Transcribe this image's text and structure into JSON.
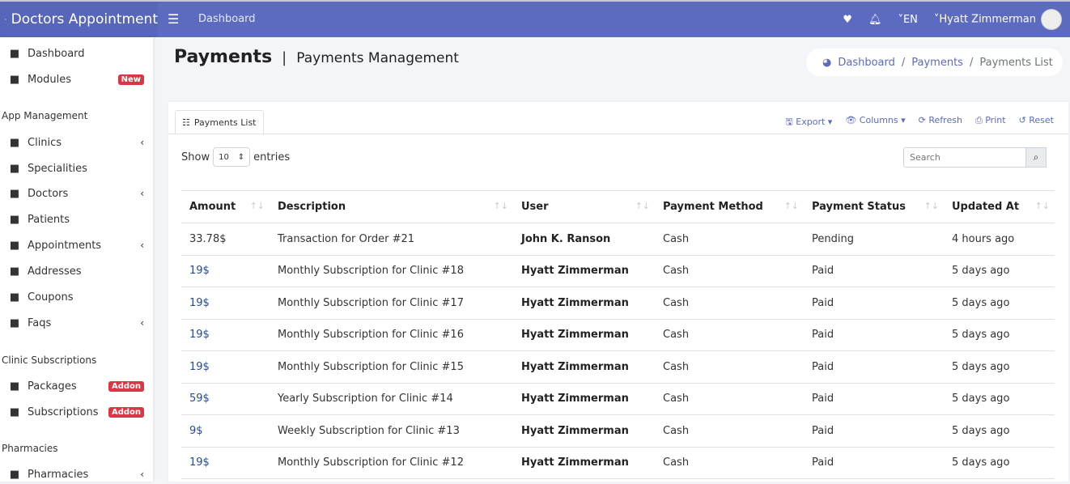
{
  "app": {
    "title": "Doctors Appointment"
  },
  "topbar": {
    "crumb": "Dashboard",
    "lang": "EN",
    "user": "Hyatt Zimmerman"
  },
  "sidebar": {
    "items": [
      {
        "label": "Dashboard",
        "icon": "tachometer-icon"
      },
      {
        "label": "Modules",
        "icon": "grid-icon",
        "badge": "New"
      },
      {
        "label": "Clinics",
        "icon": "building-icon",
        "chevron": true
      },
      {
        "label": "Specialities",
        "icon": "medical-icon"
      },
      {
        "label": "Doctors",
        "icon": "doctor-icon",
        "chevron": true
      },
      {
        "label": "Patients",
        "icon": "bed-icon"
      },
      {
        "label": "Appointments",
        "icon": "calendar-icon",
        "chevron": true
      },
      {
        "label": "Addresses",
        "icon": "map-icon"
      },
      {
        "label": "Coupons",
        "icon": "ticket-icon"
      },
      {
        "label": "Faqs",
        "icon": "question-icon",
        "chevron": true
      },
      {
        "label": "Packages",
        "icon": "list-icon",
        "badge": "Addon"
      },
      {
        "label": "Subscriptions",
        "icon": "id-card-icon",
        "badge": "Addon"
      },
      {
        "label": "Pharmacies",
        "icon": "pharmacy-icon",
        "chevron": true
      }
    ],
    "sections": [
      "App Management",
      "Clinic Subscriptions",
      "Pharmacies"
    ]
  },
  "page": {
    "title": "Payments",
    "subtitle": "Payments Management"
  },
  "breadcrumb": [
    "Dashboard",
    "Payments",
    "Payments List"
  ],
  "card": {
    "tab": "Payments List",
    "tools": [
      "Export",
      "Columns",
      "Refresh",
      "Print",
      "Reset"
    ],
    "show": "Show",
    "entries": "entries",
    "page_size": "10",
    "search_placeholder": "Search"
  },
  "table": {
    "columns": [
      "Amount",
      "Description",
      "User",
      "Payment Method",
      "Payment Status",
      "Updated At"
    ],
    "rows": [
      [
        "33.78$",
        "Transaction for Order #21",
        "John K. Ranson",
        "Cash",
        "Pending",
        "4 hours ago"
      ],
      [
        "19$",
        "Monthly Subscription for Clinic #18",
        "Hyatt Zimmerman",
        "Cash",
        "Paid",
        "5 days ago"
      ],
      [
        "19$",
        "Monthly Subscription for Clinic #17",
        "Hyatt Zimmerman",
        "Cash",
        "Paid",
        "5 days ago"
      ],
      [
        "19$",
        "Monthly Subscription for Clinic #16",
        "Hyatt Zimmerman",
        "Cash",
        "Paid",
        "5 days ago"
      ],
      [
        "19$",
        "Monthly Subscription for Clinic #15",
        "Hyatt Zimmerman",
        "Cash",
        "Paid",
        "5 days ago"
      ],
      [
        "59$",
        "Yearly Subscription for Clinic #14",
        "Hyatt Zimmerman",
        "Cash",
        "Paid",
        "5 days ago"
      ],
      [
        "9$",
        "Weekly Subscription for Clinic #13",
        "Hyatt Zimmerman",
        "Cash",
        "Paid",
        "5 days ago"
      ],
      [
        "19$",
        "Monthly Subscription for Clinic #12",
        "Hyatt Zimmerman",
        "Cash",
        "Paid",
        "5 days ago"
      ]
    ]
  },
  "colors": {
    "primary": "#5c6bc0",
    "badge": "#dc3545"
  }
}
